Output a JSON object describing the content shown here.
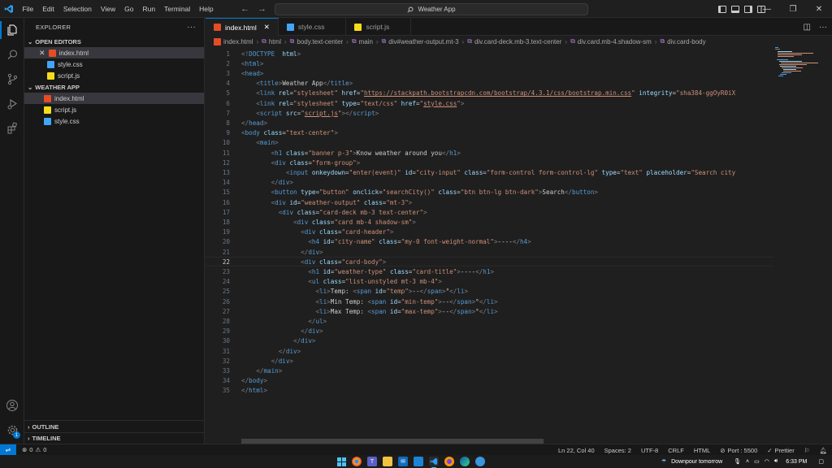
{
  "menu": [
    "File",
    "Edit",
    "Selection",
    "View",
    "Go",
    "Run",
    "Terminal",
    "Help"
  ],
  "search_text": "Weather App",
  "explorer": {
    "title": "EXPLORER",
    "open_editors_label": "OPEN EDITORS",
    "open_editors": [
      "index.html",
      "style.css",
      "script.js"
    ],
    "folder_label": "WEATHER APP",
    "files": [
      "index.html",
      "script.js",
      "style.css"
    ],
    "outline_label": "OUTLINE",
    "timeline_label": "TIMELINE"
  },
  "tabs": [
    "index.html",
    "style.css",
    "script.js"
  ],
  "breadcrumb": [
    "index.html",
    "html",
    "body.text-center",
    "main",
    "div#weather-output.mt-3",
    "div.card-deck.mb-3.text-center",
    "div.card.mb-4.shadow-sm",
    "div.card-body"
  ],
  "code": {
    "current_line": 22,
    "lines": [
      [
        [
          "p",
          "<!"
        ],
        [
          "t",
          "DOCTYPE"
        ],
        [
          "",
          "  "
        ],
        [
          "a",
          "html"
        ],
        [
          "p",
          ">"
        ]
      ],
      [
        [
          "p",
          "<"
        ],
        [
          "t",
          "html"
        ],
        [
          "p",
          ">"
        ]
      ],
      [
        [
          "p",
          "<"
        ],
        [
          "t",
          "head"
        ],
        [
          "p",
          ">"
        ]
      ],
      [
        [
          "",
          "    "
        ],
        [
          "p",
          "<"
        ],
        [
          "t",
          "title"
        ],
        [
          "p",
          ">"
        ],
        [
          "",
          "Weather App"
        ],
        [
          "p",
          "</"
        ],
        [
          "t",
          "title"
        ],
        [
          "p",
          ">"
        ]
      ],
      [
        [
          "",
          "    "
        ],
        [
          "p",
          "<"
        ],
        [
          "t",
          "link"
        ],
        [
          "",
          " "
        ],
        [
          "a",
          "rel"
        ],
        [
          "",
          "="
        ],
        [
          "s",
          "\"stylesheet\""
        ],
        [
          "",
          " "
        ],
        [
          "a",
          "href"
        ],
        [
          "",
          "="
        ],
        [
          "s",
          "\""
        ],
        [
          "u",
          "https://stackpath.bootstrapcdn.com/bootstrap/4.3.1/css/bootstrap.min.css"
        ],
        [
          "s",
          "\""
        ],
        [
          "",
          " "
        ],
        [
          "a",
          "integrity"
        ],
        [
          "",
          "="
        ],
        [
          "s",
          "\"sha384-ggOyR0iX"
        ]
      ],
      [
        [
          "",
          "    "
        ],
        [
          "p",
          "<"
        ],
        [
          "t",
          "link"
        ],
        [
          "",
          " "
        ],
        [
          "a",
          "rel"
        ],
        [
          "",
          "="
        ],
        [
          "s",
          "\"stylesheet\""
        ],
        [
          "",
          " "
        ],
        [
          "a",
          "type"
        ],
        [
          "",
          "="
        ],
        [
          "s",
          "\"text/css\""
        ],
        [
          "",
          " "
        ],
        [
          "a",
          "href"
        ],
        [
          "",
          "="
        ],
        [
          "s",
          "\""
        ],
        [
          "u",
          "style.css"
        ],
        [
          "s",
          "\""
        ],
        [
          "p",
          ">"
        ]
      ],
      [
        [
          "",
          "    "
        ],
        [
          "p",
          "<"
        ],
        [
          "t",
          "script"
        ],
        [
          "",
          " "
        ],
        [
          "a",
          "src"
        ],
        [
          "",
          "="
        ],
        [
          "s",
          "\""
        ],
        [
          "u",
          "script.js"
        ],
        [
          "s",
          "\""
        ],
        [
          "p",
          "></"
        ],
        [
          "t",
          "script"
        ],
        [
          "p",
          ">"
        ]
      ],
      [
        [
          "p",
          "</"
        ],
        [
          "t",
          "head"
        ],
        [
          "p",
          ">"
        ]
      ],
      [
        [
          "p",
          "<"
        ],
        [
          "t",
          "body"
        ],
        [
          "",
          " "
        ],
        [
          "a",
          "class"
        ],
        [
          "",
          "="
        ],
        [
          "s",
          "\"text-center\""
        ],
        [
          "p",
          ">"
        ]
      ],
      [
        [
          "",
          "    "
        ],
        [
          "p",
          "<"
        ],
        [
          "t",
          "main"
        ],
        [
          "p",
          ">"
        ]
      ],
      [
        [
          "",
          "        "
        ],
        [
          "p",
          "<"
        ],
        [
          "t",
          "h1"
        ],
        [
          "",
          " "
        ],
        [
          "a",
          "class"
        ],
        [
          "",
          "="
        ],
        [
          "s",
          "\"banner p-3\""
        ],
        [
          "p",
          ">"
        ],
        [
          "",
          "Know weather around you"
        ],
        [
          "p",
          "</"
        ],
        [
          "t",
          "h1"
        ],
        [
          "p",
          ">"
        ]
      ],
      [
        [
          "",
          "        "
        ],
        [
          "p",
          "<"
        ],
        [
          "t",
          "div"
        ],
        [
          "",
          " "
        ],
        [
          "a",
          "class"
        ],
        [
          "",
          "="
        ],
        [
          "s",
          "\"form-group\""
        ],
        [
          "p",
          ">"
        ]
      ],
      [
        [
          "",
          "            "
        ],
        [
          "p",
          "<"
        ],
        [
          "t",
          "input"
        ],
        [
          "",
          " "
        ],
        [
          "a",
          "onkeydown"
        ],
        [
          "",
          "="
        ],
        [
          "s",
          "\"enter(event)\""
        ],
        [
          "",
          " "
        ],
        [
          "a",
          "id"
        ],
        [
          "",
          "="
        ],
        [
          "s",
          "\"city-input\""
        ],
        [
          "",
          " "
        ],
        [
          "a",
          "class"
        ],
        [
          "",
          "="
        ],
        [
          "s",
          "\"form-control form-control-lg\""
        ],
        [
          "",
          " "
        ],
        [
          "a",
          "type"
        ],
        [
          "",
          "="
        ],
        [
          "s",
          "\"text\""
        ],
        [
          "",
          " "
        ],
        [
          "a",
          "placeholder"
        ],
        [
          "",
          "="
        ],
        [
          "s",
          "\"Search city"
        ]
      ],
      [
        [
          "",
          "        "
        ],
        [
          "p",
          "</"
        ],
        [
          "t",
          "div"
        ],
        [
          "p",
          ">"
        ]
      ],
      [
        [
          "",
          "        "
        ],
        [
          "p",
          "<"
        ],
        [
          "t",
          "button"
        ],
        [
          "",
          " "
        ],
        [
          "a",
          "type"
        ],
        [
          "",
          "="
        ],
        [
          "s",
          "\"button\""
        ],
        [
          "",
          " "
        ],
        [
          "a",
          "onclick"
        ],
        [
          "",
          "="
        ],
        [
          "s",
          "\"searchCity()\""
        ],
        [
          "",
          " "
        ],
        [
          "a",
          "class"
        ],
        [
          "",
          "="
        ],
        [
          "s",
          "\"btn btn-lg btn-dark\""
        ],
        [
          "p",
          ">"
        ],
        [
          "",
          "Search"
        ],
        [
          "p",
          "</"
        ],
        [
          "t",
          "button"
        ],
        [
          "p",
          ">"
        ]
      ],
      [
        [
          "",
          "        "
        ],
        [
          "p",
          "<"
        ],
        [
          "t",
          "div"
        ],
        [
          "",
          " "
        ],
        [
          "a",
          "id"
        ],
        [
          "",
          "="
        ],
        [
          "s",
          "\"weather-output\""
        ],
        [
          "",
          " "
        ],
        [
          "a",
          "class"
        ],
        [
          "",
          "="
        ],
        [
          "s",
          "\"mt-3\""
        ],
        [
          "p",
          ">"
        ]
      ],
      [
        [
          "",
          "          "
        ],
        [
          "p",
          "<"
        ],
        [
          "t",
          "div"
        ],
        [
          "",
          " "
        ],
        [
          "a",
          "class"
        ],
        [
          "",
          "="
        ],
        [
          "s",
          "\"card-deck mb-3 text-center\""
        ],
        [
          "p",
          ">"
        ]
      ],
      [
        [
          "",
          "              "
        ],
        [
          "p",
          "<"
        ],
        [
          "t",
          "div"
        ],
        [
          "",
          " "
        ],
        [
          "a",
          "class"
        ],
        [
          "",
          "="
        ],
        [
          "s",
          "\"card mb-4 shadow-sm\""
        ],
        [
          "p",
          ">"
        ]
      ],
      [
        [
          "",
          "                "
        ],
        [
          "p",
          "<"
        ],
        [
          "t",
          "div"
        ],
        [
          "",
          " "
        ],
        [
          "a",
          "class"
        ],
        [
          "",
          "="
        ],
        [
          "s",
          "\"card-header\""
        ],
        [
          "p",
          ">"
        ]
      ],
      [
        [
          "",
          "                  "
        ],
        [
          "p",
          "<"
        ],
        [
          "t",
          "h4"
        ],
        [
          "",
          " "
        ],
        [
          "a",
          "id"
        ],
        [
          "",
          "="
        ],
        [
          "s",
          "\"city-name\""
        ],
        [
          "",
          " "
        ],
        [
          "a",
          "class"
        ],
        [
          "",
          "="
        ],
        [
          "s",
          "\"my-0 font-weight-normal\""
        ],
        [
          "p",
          ">"
        ],
        [
          "",
          "----"
        ],
        [
          "p",
          "</"
        ],
        [
          "t",
          "h4"
        ],
        [
          "p",
          ">"
        ]
      ],
      [
        [
          "",
          "                "
        ],
        [
          "p",
          "</"
        ],
        [
          "t",
          "div"
        ],
        [
          "p",
          ">"
        ]
      ],
      [
        [
          "",
          "                "
        ],
        [
          "p",
          "<"
        ],
        [
          "t",
          "div"
        ],
        [
          "",
          " "
        ],
        [
          "a",
          "class"
        ],
        [
          "",
          "="
        ],
        [
          "s",
          "\"card-body\""
        ],
        [
          "p",
          ">"
        ]
      ],
      [
        [
          "",
          "                  "
        ],
        [
          "p",
          "<"
        ],
        [
          "t",
          "h1"
        ],
        [
          "",
          " "
        ],
        [
          "a",
          "id"
        ],
        [
          "",
          "="
        ],
        [
          "s",
          "\"weather-type\""
        ],
        [
          "",
          " "
        ],
        [
          "a",
          "class"
        ],
        [
          "",
          "="
        ],
        [
          "s",
          "\"card-title\""
        ],
        [
          "p",
          ">"
        ],
        [
          "",
          "----"
        ],
        [
          "p",
          "</"
        ],
        [
          "t",
          "h1"
        ],
        [
          "p",
          ">"
        ]
      ],
      [
        [
          "",
          "                  "
        ],
        [
          "p",
          "<"
        ],
        [
          "t",
          "ul"
        ],
        [
          "",
          " "
        ],
        [
          "a",
          "class"
        ],
        [
          "",
          "="
        ],
        [
          "s",
          "\"list-unstyled mt-3 mb-4\""
        ],
        [
          "p",
          ">"
        ]
      ],
      [
        [
          "",
          "                    "
        ],
        [
          "p",
          "<"
        ],
        [
          "t",
          "li"
        ],
        [
          "p",
          ">"
        ],
        [
          "",
          "Temp: "
        ],
        [
          "p",
          "<"
        ],
        [
          "t",
          "span"
        ],
        [
          "",
          " "
        ],
        [
          "a",
          "id"
        ],
        [
          "",
          "="
        ],
        [
          "s",
          "\"temp\""
        ],
        [
          "p",
          ">"
        ],
        [
          "",
          "--"
        ],
        [
          "p",
          "</"
        ],
        [
          "t",
          "span"
        ],
        [
          "p",
          ">"
        ],
        [
          "",
          "°"
        ],
        [
          "p",
          "</"
        ],
        [
          "t",
          "li"
        ],
        [
          "p",
          ">"
        ]
      ],
      [
        [
          "",
          "                    "
        ],
        [
          "p",
          "<"
        ],
        [
          "t",
          "li"
        ],
        [
          "p",
          ">"
        ],
        [
          "",
          "Min Temp: "
        ],
        [
          "p",
          "<"
        ],
        [
          "t",
          "span"
        ],
        [
          "",
          " "
        ],
        [
          "a",
          "id"
        ],
        [
          "",
          "="
        ],
        [
          "s",
          "\"min-temp\""
        ],
        [
          "p",
          ">"
        ],
        [
          "",
          "--"
        ],
        [
          "p",
          "</"
        ],
        [
          "t",
          "span"
        ],
        [
          "p",
          ">"
        ],
        [
          "",
          "°"
        ],
        [
          "p",
          "</"
        ],
        [
          "t",
          "li"
        ],
        [
          "p",
          ">"
        ]
      ],
      [
        [
          "",
          "                    "
        ],
        [
          "p",
          "<"
        ],
        [
          "t",
          "li"
        ],
        [
          "p",
          ">"
        ],
        [
          "",
          "Max Temp: "
        ],
        [
          "p",
          "<"
        ],
        [
          "t",
          "span"
        ],
        [
          "",
          " "
        ],
        [
          "a",
          "id"
        ],
        [
          "",
          "="
        ],
        [
          "s",
          "\"max-temp\""
        ],
        [
          "p",
          ">"
        ],
        [
          "",
          "--"
        ],
        [
          "p",
          "</"
        ],
        [
          "t",
          "span"
        ],
        [
          "p",
          ">"
        ],
        [
          "",
          "°"
        ],
        [
          "p",
          "</"
        ],
        [
          "t",
          "li"
        ],
        [
          "p",
          ">"
        ]
      ],
      [
        [
          "",
          "                  "
        ],
        [
          "p",
          "</"
        ],
        [
          "t",
          "ul"
        ],
        [
          "p",
          ">"
        ]
      ],
      [
        [
          "",
          "                "
        ],
        [
          "p",
          "</"
        ],
        [
          "t",
          "div"
        ],
        [
          "p",
          ">"
        ]
      ],
      [
        [
          "",
          "              "
        ],
        [
          "p",
          "</"
        ],
        [
          "t",
          "div"
        ],
        [
          "p",
          ">"
        ]
      ],
      [
        [
          "",
          "          "
        ],
        [
          "p",
          "</"
        ],
        [
          "t",
          "div"
        ],
        [
          "p",
          ">"
        ]
      ],
      [
        [
          "",
          "        "
        ],
        [
          "p",
          "</"
        ],
        [
          "t",
          "div"
        ],
        [
          "p",
          ">"
        ]
      ],
      [
        [
          "",
          "    "
        ],
        [
          "p",
          "</"
        ],
        [
          "t",
          "main"
        ],
        [
          "p",
          ">"
        ]
      ],
      [
        [
          "p",
          "</"
        ],
        [
          "t",
          "body"
        ],
        [
          "p",
          ">"
        ]
      ],
      [
        [
          "p",
          "</"
        ],
        [
          "t",
          "html"
        ],
        [
          "p",
          ">"
        ]
      ]
    ]
  },
  "status": {
    "errors": "0",
    "warnings": "0",
    "position": "Ln 22, Col 40",
    "spaces": "Spaces: 2",
    "encoding": "UTF-8",
    "eol": "CRLF",
    "language": "HTML",
    "port": "Port : 5500",
    "prettier": "Prettier"
  },
  "taskbar": {
    "weather": "Downpour tomorrow",
    "time": "6:33 PM"
  },
  "colors": {
    "accent": "#0078d4",
    "tag": "#569cd6",
    "attr": "#9cdcfe",
    "string": "#ce9178"
  }
}
